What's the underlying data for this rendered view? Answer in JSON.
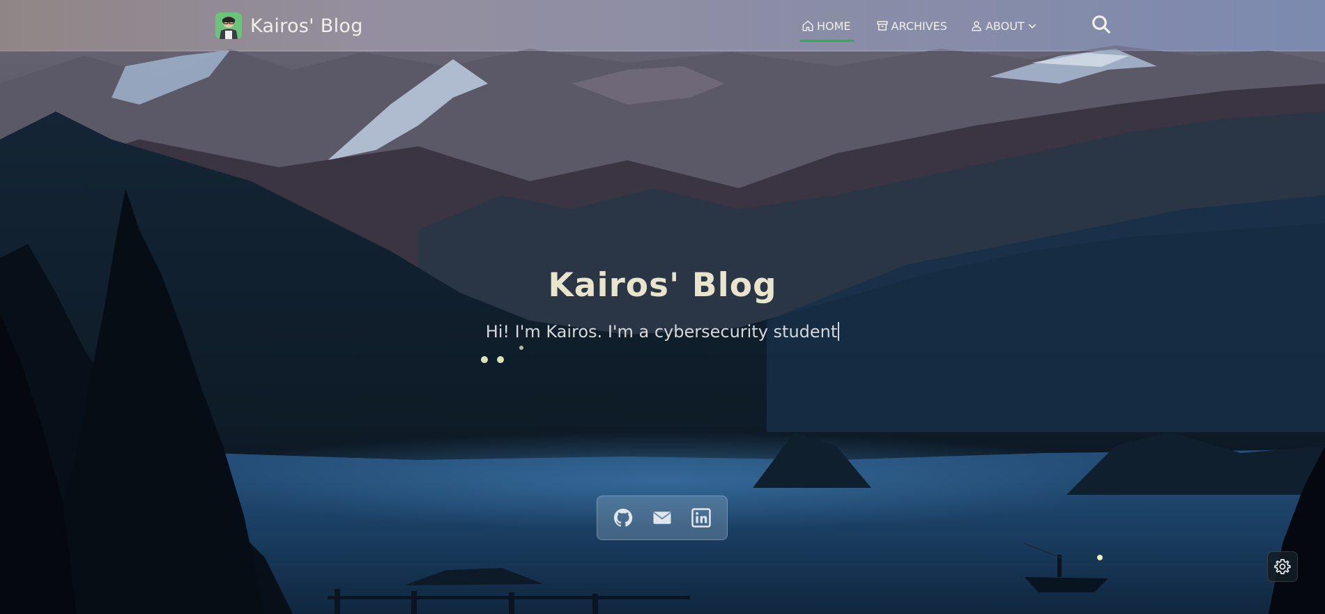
{
  "header": {
    "brand_title": "Kairos' Blog",
    "nav": [
      {
        "label": "HOME",
        "icon": "home-icon",
        "active": true
      },
      {
        "label": "ARCHIVES",
        "icon": "archive-icon"
      },
      {
        "label": "ABOUT",
        "icon": "user-icon",
        "has_dropdown": true
      }
    ],
    "search_icon": "search-icon",
    "active_indicator_color": "#27b24a"
  },
  "hero": {
    "title": "Kairos' Blog",
    "subtitle": "Hi! I'm Kairos. I'm a cybersecurity student"
  },
  "social": [
    {
      "icon": "github-icon"
    },
    {
      "icon": "mail-icon"
    },
    {
      "icon": "linkedin-icon"
    }
  ],
  "settings_icon": "gear-icon",
  "colors": {
    "title_text": "#e9e4cc",
    "accent_green": "#27b24a"
  }
}
